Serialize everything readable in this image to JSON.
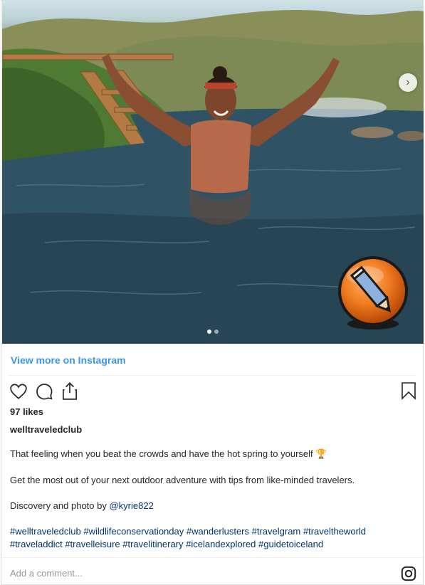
{
  "post": {
    "view_more": "View more on Instagram",
    "likes": "97 likes",
    "username": "welltraveledclub",
    "caption_line1": "That feeling when you beat the crowds and have the hot spring to yourself",
    "caption_emoji": "🏆",
    "caption_line2": "Get the most out of your next outdoor adventure with tips from like-minded travelers.",
    "caption_line3_prefix": "Discovery and photo by ",
    "caption_mention": "@kyrie822",
    "hashtags_line1": "#welltraveledclub #wildlifeconservationday #wanderlusters #travelgram #traveltheworld",
    "hashtags_line2": "#traveladdict #travelleisure #travelitinerary #icelandexplored #guidetoiceland",
    "add_comment_placeholder": "Add a comment..."
  },
  "carousel": {
    "next_glyph": "›",
    "slide_count": 2,
    "active_slide": 1
  },
  "icons": {
    "like": "heart-icon",
    "comment": "comment-icon",
    "share": "share-icon",
    "save": "bookmark-icon",
    "brand": "instagram-icon",
    "edit": "pencil-edit-icon"
  },
  "colors": {
    "link": "#3897f0",
    "hashtag": "#003569",
    "badge": "#f07a20"
  }
}
